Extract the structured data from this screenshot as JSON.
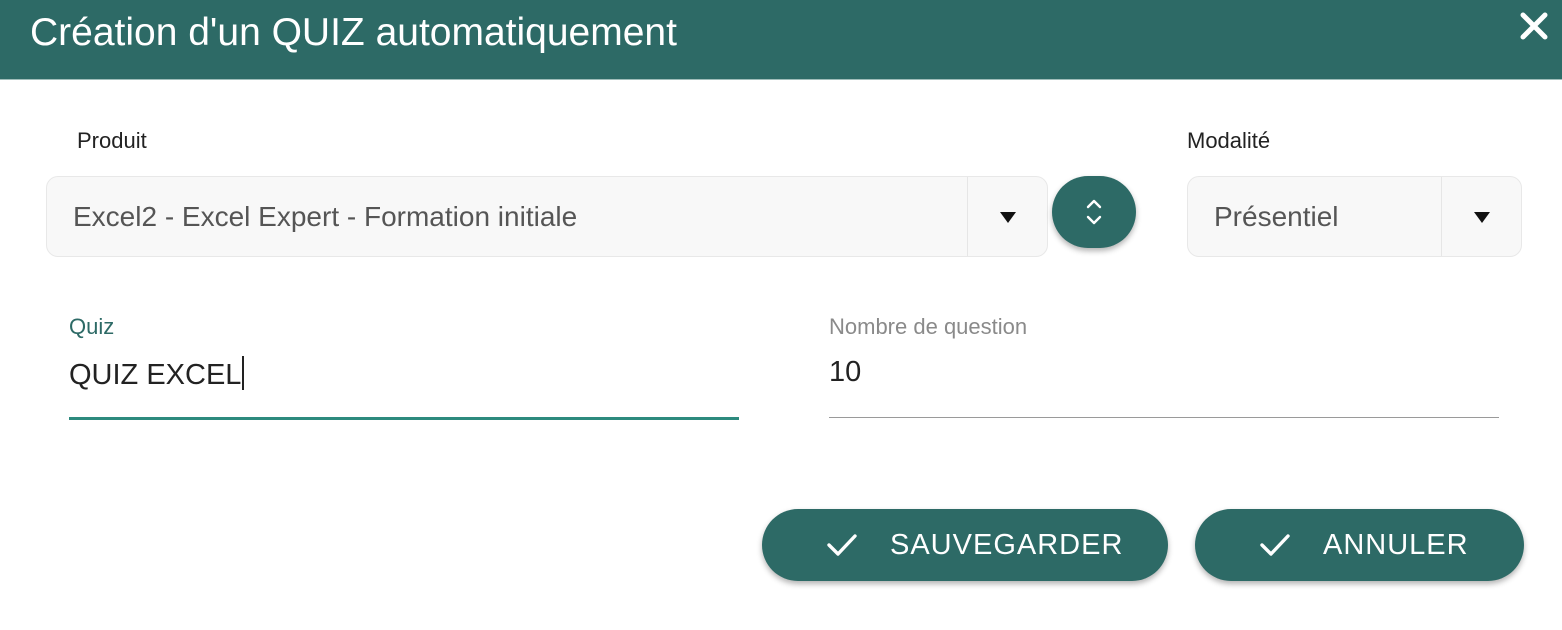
{
  "dialog": {
    "title": "Création d'un QUIZ automatiquement",
    "close_icon": "close-icon"
  },
  "produit": {
    "label": "Produit",
    "selected": "Excel2 - Excel Expert - Formation initiale",
    "options": [
      "Excel2 - Excel Expert - Formation initiale"
    ]
  },
  "sort_button": {
    "icon": "chevron-up-down-icon"
  },
  "modalite": {
    "label": "Modalité",
    "selected": "Présentiel",
    "options": [
      "Présentiel"
    ]
  },
  "quiz": {
    "label": "Quiz",
    "value": "QUIZ EXCEL"
  },
  "nombre_question": {
    "label": "Nombre de question",
    "value": "10"
  },
  "actions": {
    "save_label": "SAUVEGARDER",
    "cancel_label": "ANNULER",
    "icon": "check-icon"
  },
  "colors": {
    "primary": "#2d6a66",
    "focus_underline": "#2d8a7e",
    "muted_label": "#8a8a8a"
  }
}
